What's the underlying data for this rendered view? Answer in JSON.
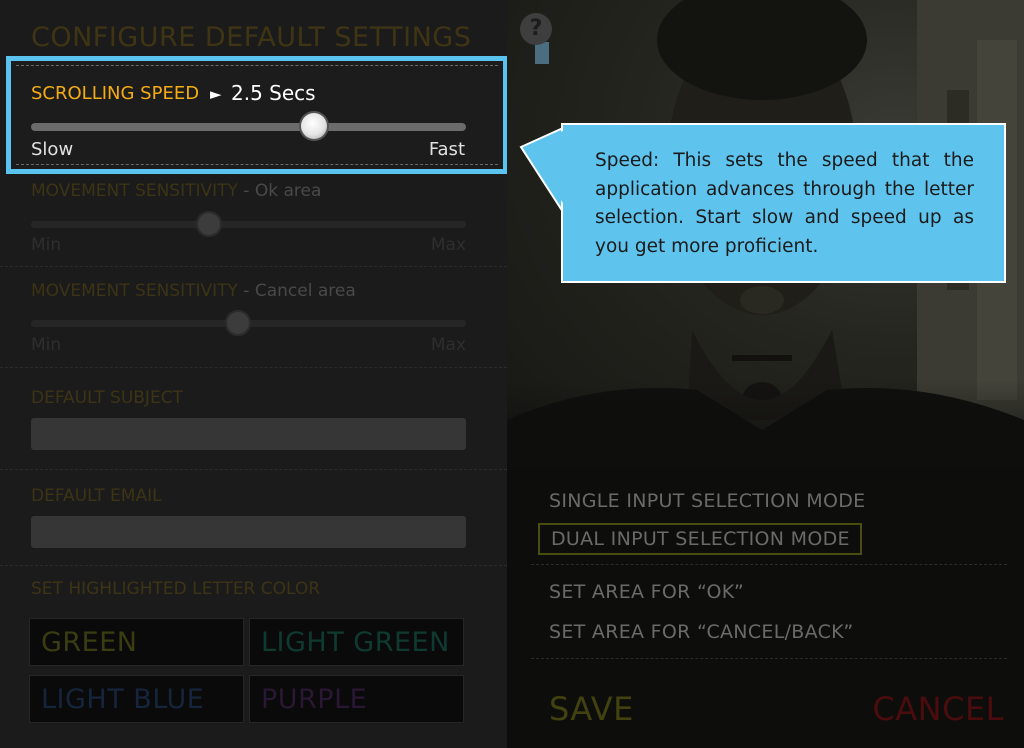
{
  "left_panel": {
    "title": "CONFIGURE DEFAULT SETTINGS",
    "scrolling_speed": {
      "label": "SCROLLING SPEED",
      "arrow": "►",
      "value": "2.5 Secs",
      "min_label": "Slow",
      "max_label": "Fast",
      "level": 0.65
    },
    "ok_sensitivity": {
      "label": "MOVEMENT SENSITIVITY",
      "sub": " - Ok area",
      "min_label": "Min",
      "max_label": "Max",
      "level": 0.41
    },
    "cancel_sensitivity": {
      "label": "MOVEMENT SENSITIVITY",
      "sub": " - Cancel area",
      "min_label": "Min",
      "max_label": "Max",
      "level": 0.475
    },
    "default_subject": {
      "label": "DEFAULT SUBJECT",
      "value": ""
    },
    "default_email": {
      "label": "DEFAULT EMAIL",
      "value": ""
    },
    "highlight_color": {
      "label": "SET HIGHLIGHTED LETTER COLOR",
      "options": [
        {
          "label": "GREEN",
          "color": "#3a3d12"
        },
        {
          "label": "LIGHT GREEN",
          "color": "#0f3a30"
        },
        {
          "label": "LIGHT BLUE",
          "color": "#15253c"
        },
        {
          "label": "PURPLE",
          "color": "#2a1733"
        }
      ]
    }
  },
  "right_panel": {
    "help_icon": "?",
    "modes": {
      "single": "SINGLE INPUT SELECTION MODE",
      "dual": "DUAL INPUT SELECTION MODE"
    },
    "set_ok": "SET AREA FOR “OK”",
    "set_cancel": "SET AREA FOR “CANCEL/BACK”",
    "save_label": "SAVE",
    "cancel_label": "CANCEL"
  },
  "callout": {
    "text": "Speed: This sets the speed that the application advances through the letter selection. Start slow and speed up as you get more proficient."
  },
  "colors": {
    "highlight_border": "#5bc3ef",
    "accent_orange": "#f5ac12",
    "callout_bg": "#5ec4ee"
  }
}
